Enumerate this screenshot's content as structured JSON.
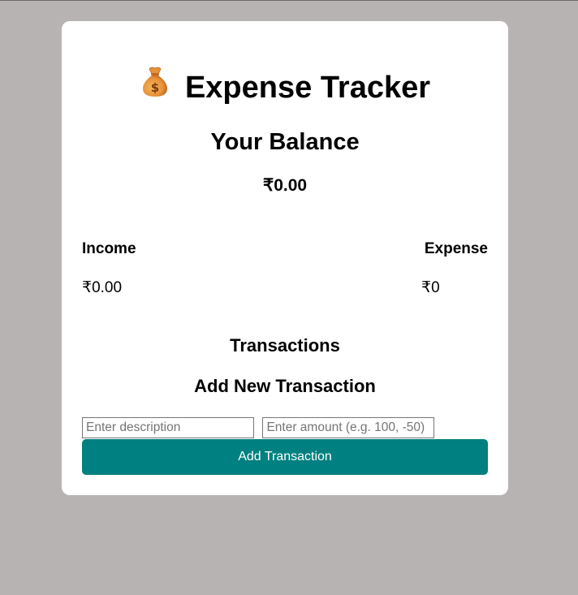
{
  "app": {
    "title": "Expense Tracker",
    "title_icon": "money-bag-icon"
  },
  "balance": {
    "heading": "Your Balance",
    "amount": "₹0.00"
  },
  "income": {
    "label": "Income",
    "amount": "₹0.00"
  },
  "expense": {
    "label": "Expense",
    "amount": "₹0"
  },
  "transactions": {
    "heading": "Transactions"
  },
  "add_form": {
    "heading": "Add New Transaction",
    "description": {
      "value": "",
      "placeholder": "Enter description"
    },
    "amount": {
      "value": "",
      "placeholder": "Enter amount (e.g. 100, -50)"
    },
    "submit_label": "Add Transaction"
  },
  "colors": {
    "background": "#b8b3b3",
    "card": "#ffffff",
    "accent": "#008080",
    "money_bag": "#e8923a"
  }
}
